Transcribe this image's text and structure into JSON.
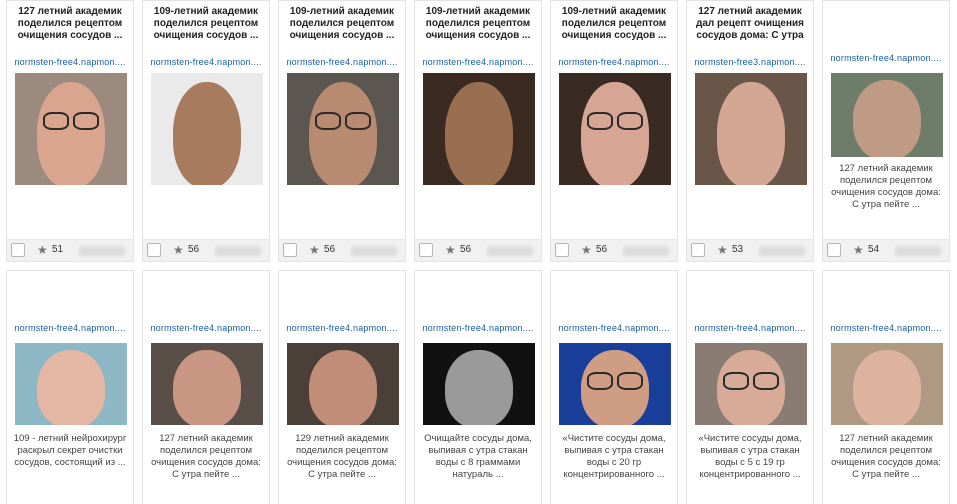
{
  "cards": [
    {
      "title": "127 летний академик поделился рецептом очищения сосудов ...",
      "url": "normsten-free4.napmon....",
      "likes": "51",
      "desc": "",
      "skin": "#d9a58f",
      "bg": "#9c8a7e",
      "glasses": true
    },
    {
      "title": "109-летний академик поделился рецептом очищения сосудов ...",
      "url": "normsten-free4.napmon....",
      "likes": "56",
      "desc": "",
      "skin": "#a87a5e",
      "bg": "#eaeaea",
      "glasses": false
    },
    {
      "title": "109-летний академик поделился рецептом очищения сосудов ...",
      "url": "normsten-free4.napmon....",
      "likes": "56",
      "desc": "",
      "skin": "#b98a72",
      "bg": "#5c5650",
      "glasses": true
    },
    {
      "title": "109-летний академик поделился рецептом очищения сосудов ...",
      "url": "normsten-free4.napmon....",
      "likes": "56",
      "desc": "",
      "skin": "#9a6e50",
      "bg": "#3a2a22",
      "glasses": false
    },
    {
      "title": "109-летний академик поделился рецептом очищения сосудов ...",
      "url": "normsten-free4.napmon....",
      "likes": "56",
      "desc": "",
      "skin": "#d7a593",
      "bg": "#3a2a24",
      "glasses": true
    },
    {
      "title": "127 летний академик дал рецепт очищения сосудов дома: С утра ...",
      "url": "normsten-free3.napmon....",
      "likes": "53",
      "desc": "",
      "skin": "#d3a693",
      "bg": "#6a5648",
      "glasses": false
    },
    {
      "title": "",
      "url": "normsten-free4.napmon....",
      "likes": "54",
      "desc": "127 летний академик поделился рецептом очищения сосудов дома: С утра пейте ...",
      "skin": "#bf9b85",
      "bg": "#6e7d6a",
      "glasses": false
    },
    {
      "title": "",
      "url": "normsten-free4.napmon....",
      "likes": "",
      "desc": "109 - летний нейрохирург раскрыл секрет очистки сосудов, состоящий из ...",
      "skin": "#e3b7a3",
      "bg": "#8db7c5",
      "glasses": false
    },
    {
      "title": "",
      "url": "normsten-free4.napmon....",
      "likes": "",
      "desc": "127 летний академик поделился рецептом очищения сосудов дома: С утра пейте ...",
      "skin": "#c99683",
      "bg": "#5a4e48",
      "glasses": false
    },
    {
      "title": "",
      "url": "normsten-free4.napmon....",
      "likes": "",
      "desc": "129 летний академик поделился рецептом очищения сосудов дома: С утра пейте ...",
      "skin": "#c28d78",
      "bg": "#4b3f3a",
      "glasses": false
    },
    {
      "title": "",
      "url": "normsten-free4.napmon....",
      "likes": "",
      "desc": "Очищайте сосуды дома, выпивая с утра стакан воды с 8 граммами натураль ...",
      "skin": "#9a9a9a",
      "bg": "#111111",
      "glasses": false
    },
    {
      "title": "",
      "url": "normsten-free4.napmon....",
      "likes": "",
      "desc": "«Чистите сосуды дома, выпивая с утра стакан воды с 20 гр концентрированного ...",
      "skin": "#cf9d84",
      "bg": "#1a3f9a",
      "glasses": true
    },
    {
      "title": "",
      "url": "normsten-free4.napmon....",
      "likes": "",
      "desc": "«Чистите сосуды дома, выпивая с утра стакан воды с 5 с 19 гр концентрированного ...",
      "skin": "#d7ab98",
      "bg": "#8a7c72",
      "glasses": true
    },
    {
      "title": "",
      "url": "normsten-free4.napmon....",
      "likes": "",
      "desc": "127 летний академик поделился рецептом очищения сосудов дома: С утра пейте ...",
      "skin": "#dbb39e",
      "bg": "#b09982",
      "glasses": false
    }
  ],
  "icons": {
    "star": "star-icon",
    "checkbox": "checkbox-icon"
  }
}
